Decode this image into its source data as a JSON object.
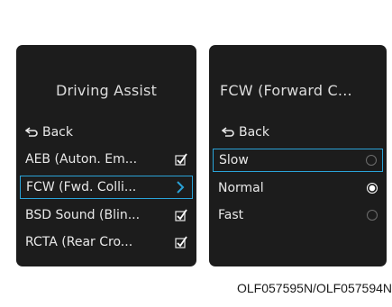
{
  "left_panel": {
    "title": "Driving Assist",
    "back_label": "Back",
    "items": [
      {
        "label": "AEB (Auton. Em...",
        "control": "check"
      },
      {
        "label": "FCW (Fwd. Colli...",
        "control": "chevron",
        "selected": true
      },
      {
        "label": "BSD Sound (Blin...",
        "control": "check"
      },
      {
        "label": "RCTA (Rear Cro...",
        "control": "check"
      }
    ]
  },
  "right_panel": {
    "title": "FCW (Forward C...",
    "back_label": "Back",
    "options": [
      {
        "label": "Slow",
        "radio": "off",
        "selected": true
      },
      {
        "label": "Normal",
        "radio": "on"
      },
      {
        "label": "Fast",
        "radio": "off"
      }
    ]
  },
  "caption": "OLF057595N/OLF057594N",
  "colors": {
    "panel_bg": "#1c1c1c",
    "accent": "#2aa3d8"
  },
  "icons": {
    "back": "return-arrow-icon",
    "check": "checkbox-checked-icon",
    "chevron": "chevron-right-icon",
    "radio": "radio-button-icon"
  }
}
